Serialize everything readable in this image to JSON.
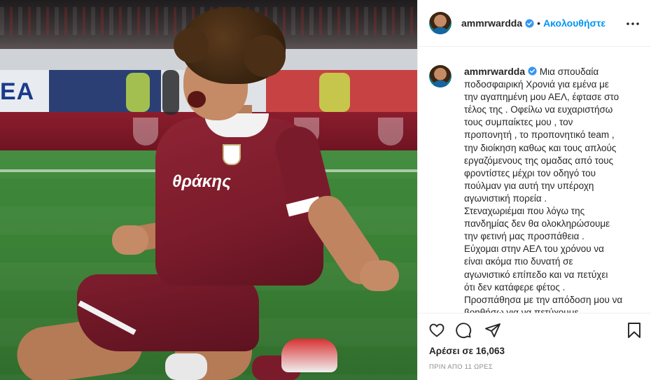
{
  "post": {
    "username": "ammrwardda",
    "follow_label": "Ακολουθήστε",
    "dot_separator": "•",
    "caption_lines": [
      "Μια σπουδαία",
      "ποδοσφαιρική Χρονιά για εμένα με",
      "την αγαπημένη μου ΑΕΛ, έφτασε στο",
      "τέλος της . Οφείλω να ευχαριστήσω",
      "τους συμπαίκτες μου , τον",
      "προπονητή , το προπονητικό team ,",
      "την διοίκηση καθως και τους απλούς",
      "εργαζόμενους της ομαδας από τους",
      "φροντίστες μέχρι τον οδηγό του",
      "πούλμαν για αυτή την υπέροχη",
      "αγωνιστική πορεία .",
      "Στεναχωριέμαι που λόγω της",
      "πανδημίας δεν θα ολοκληρώσουμε",
      "την φετινή μας προσπάθεια .",
      "Εύχομαι στην ΑΕΛ του χρόνου να",
      "είναι ακόμα πιο δυνατή σε",
      "αγωνιστικό επίπεδο και να πετύχει",
      "ότι δεν κατάφερε φέτος .",
      "Προσπάθησα με την απόδοση μου να",
      "βοηθήσω για να πετύχουμε"
    ],
    "likes_text": "Αρέσει σε 16,063",
    "timestamp": "ΠΡΙΝ ΑΠΟ 11 ΩΡΕΣ"
  },
  "photo": {
    "jersey_sponsor": "θράκης",
    "board_text": "EA"
  },
  "icons": {
    "verified": "verified-badge-icon",
    "more": "more-options-icon",
    "like": "heart-icon",
    "comment": "comment-icon",
    "share": "share-icon",
    "save": "bookmark-icon"
  },
  "colors": {
    "accent": "#0095f6",
    "text": "#262626",
    "muted": "#8e8e8e",
    "border": "#efefef"
  }
}
